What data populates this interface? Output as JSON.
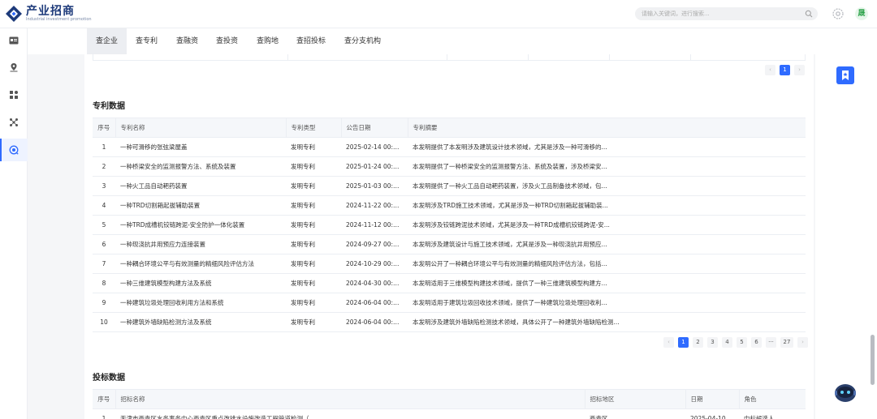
{
  "app": {
    "logo_title": "产业招商",
    "logo_subtitle": "Industrial investment promotion"
  },
  "header": {
    "search_placeholder": "请输入关键词，进行搜索...",
    "avatar_letter": "晟"
  },
  "tabs": [
    {
      "label": "查企业",
      "active": true
    },
    {
      "label": "查专利",
      "active": false
    },
    {
      "label": "查融资",
      "active": false
    },
    {
      "label": "查投资",
      "active": false
    },
    {
      "label": "查购地",
      "active": false
    },
    {
      "label": "查招投标",
      "active": false
    },
    {
      "label": "查分支机构",
      "active": false
    }
  ],
  "rail": {
    "items": [
      {
        "icon": "id-card-icon"
      },
      {
        "icon": "location-pin-icon"
      },
      {
        "icon": "grid-apps-icon"
      },
      {
        "icon": "network-nodes-icon"
      },
      {
        "icon": "radar-target-icon",
        "active": true
      }
    ]
  },
  "top_pager": {
    "current": "1"
  },
  "patents": {
    "title": "专利数据",
    "headers": [
      "序号",
      "专利名称",
      "专利类型",
      "公告日期",
      "专利摘要"
    ],
    "rows": [
      [
        "1",
        "一种可滑移的张弦梁屋盖",
        "发明专利",
        "2025-02-14 00:00:00",
        "本发明提供了本发明涉及建筑设计技术领域，尤其是涉及一种可滑移的..."
      ],
      [
        "2",
        "一种桥梁安全的监测报警方法、系统及装置",
        "发明专利",
        "2025-01-24 00:00:00",
        "本发明提供了一种桥梁安全的监测报警方法、系统及装置，涉及桥梁安..."
      ],
      [
        "3",
        "一种火工品自动耙药装置",
        "发明专利",
        "2025-01-03 00:00:00",
        "本发明提供了一种火工品自动耙药装置，涉及火工品制备技术领域，包..."
      ],
      [
        "4",
        "一种TRD切割箱起拔辅助装置",
        "发明专利",
        "2024-11-22 00:00:00",
        "本发明涉及TRD施工技术领域，尤其是涉及一种TRD切割箱起拔辅助装..."
      ],
      [
        "5",
        "一种TRD成槽机铰链跨泥-安全防护一体化装置",
        "发明专利",
        "2024-11-12 00:00:00",
        "本发明涉及铰链跨泥技术领域，尤其是涉及一种TRD成槽机铰链跨泥-安..."
      ],
      [
        "6",
        "一种现浇抗井用预应力连接装置",
        "发明专利",
        "2024-09-27 00:00:00",
        "本发明涉及建筑设计与施工技术领域，尤其是涉及一种现浇抗井用预应..."
      ],
      [
        "7",
        "一种耦合环境公平与有效测量的精细风险评估方法",
        "发明专利",
        "2024-10-29 00:00:00",
        "本发明公开了一种耦合环境公平与有效测量的精细风险评估方法，包括..."
      ],
      [
        "8",
        "一种三维建筑模型构建方法及系统",
        "发明专利",
        "2024-04-30 00:00:00",
        "本发明适用于三维模型构建技术领域，提供了一种三维建筑模型构建方..."
      ],
      [
        "9",
        "一种建筑垃圾处理回收利用方法和系统",
        "发明专利",
        "2024-06-04 00:00:00",
        "本发明适用于建筑垃圾回收技术领域，提供了一种建筑垃圾处理回收利..."
      ],
      [
        "10",
        "一种建筑外墙缺陷检测方法及系统",
        "发明专利",
        "2024-06-04 00:00:00",
        "本发明涉及建筑外墙缺陷检测技术领域，具体公开了一种建筑外墙缺陷检测..."
      ]
    ],
    "pager": [
      "1",
      "2",
      "3",
      "4",
      "5",
      "6",
      "···",
      "27"
    ]
  },
  "bids": {
    "title": "投标数据",
    "headers": [
      "序号",
      "招标名称",
      "招标地区",
      "日期",
      "角色"
    ],
    "rows": [
      [
        "1",
        "天津市西青区水务事务中心西青区重点改排水设施改造工程管道检测（...",
        "西青区",
        "2025-04-10",
        "中标候选人"
      ]
    ]
  }
}
